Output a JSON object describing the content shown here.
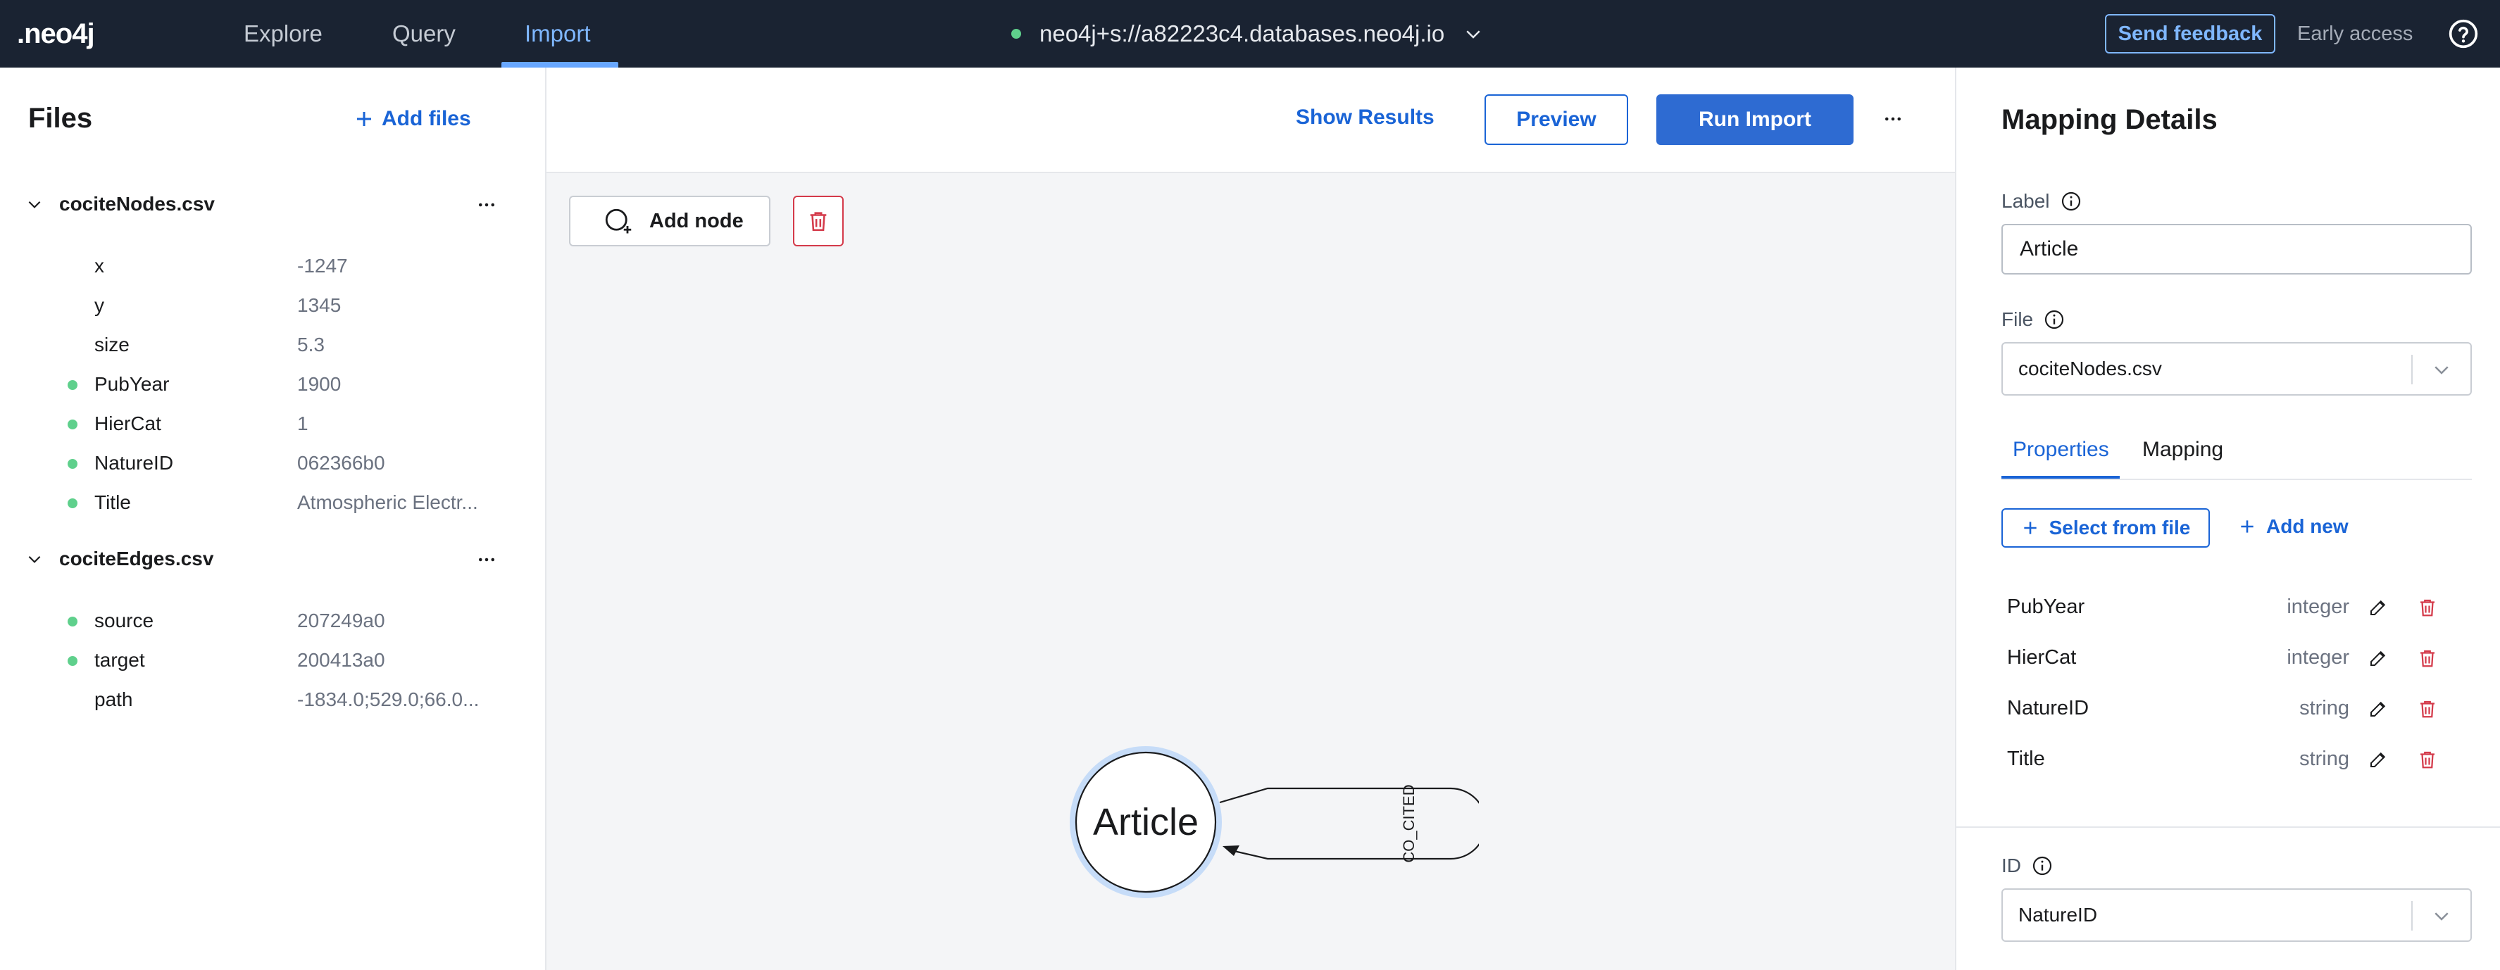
{
  "app": {
    "logo_text": ".neo4j"
  },
  "nav": {
    "tabs": [
      {
        "label": "Explore"
      },
      {
        "label": "Query"
      },
      {
        "label": "Import"
      }
    ],
    "connection": "neo4j+s://a82223c4.databases.neo4j.io",
    "feedback_label": "Send feedback",
    "early_access_label": "Early access"
  },
  "files_panel": {
    "title": "Files",
    "add_files_label": "Add files",
    "files": [
      {
        "name": "cociteNodes.csv",
        "props": [
          {
            "name": "x",
            "value": "-1247",
            "mapped": false
          },
          {
            "name": "y",
            "value": "1345",
            "mapped": false
          },
          {
            "name": "size",
            "value": "5.3",
            "mapped": false
          },
          {
            "name": "PubYear",
            "value": "1900",
            "mapped": true
          },
          {
            "name": "HierCat",
            "value": "1",
            "mapped": true
          },
          {
            "name": "NatureID",
            "value": "062366b0",
            "mapped": true
          },
          {
            "name": "Title",
            "value": "Atmospheric Electr...",
            "mapped": true
          }
        ]
      },
      {
        "name": "cociteEdges.csv",
        "props": [
          {
            "name": "source",
            "value": "207249a0",
            "mapped": true
          },
          {
            "name": "target",
            "value": "200413a0",
            "mapped": true
          },
          {
            "name": "path",
            "value": "-1834.0;529.0;66.0...",
            "mapped": false
          }
        ]
      }
    ]
  },
  "toolbar": {
    "show_results_label": "Show Results",
    "preview_label": "Preview",
    "run_import_label": "Run Import"
  },
  "canvas": {
    "add_node_label": "Add node",
    "node_label": "Article",
    "relationship_label": "CO_CITED"
  },
  "mapping": {
    "title": "Mapping Details",
    "label_field": {
      "label": "Label",
      "value": "Article"
    },
    "file_field": {
      "label": "File",
      "value": "cociteNodes.csv"
    },
    "tabs": [
      {
        "label": "Properties"
      },
      {
        "label": "Mapping"
      }
    ],
    "select_from_file_label": "Select from file",
    "add_new_label": "Add new",
    "properties": [
      {
        "name": "PubYear",
        "type": "integer"
      },
      {
        "name": "HierCat",
        "type": "integer"
      },
      {
        "name": "NatureID",
        "type": "string"
      },
      {
        "name": "Title",
        "type": "string"
      }
    ],
    "id_field": {
      "label": "ID",
      "value": "NatureID"
    }
  },
  "colors": {
    "topbar_bg": "#1a2332",
    "accent": "#1a64d6",
    "active_tab": "#7fb7ff",
    "mapped_dot": "#5fd08c",
    "danger": "#d43a4a",
    "canvas_bg": "#f4f5f7"
  },
  "icons": [
    "chevron-down-icon",
    "help-icon",
    "plus-icon",
    "more-icon",
    "add-node-icon",
    "trash-icon",
    "info-icon",
    "pencil-icon"
  ]
}
